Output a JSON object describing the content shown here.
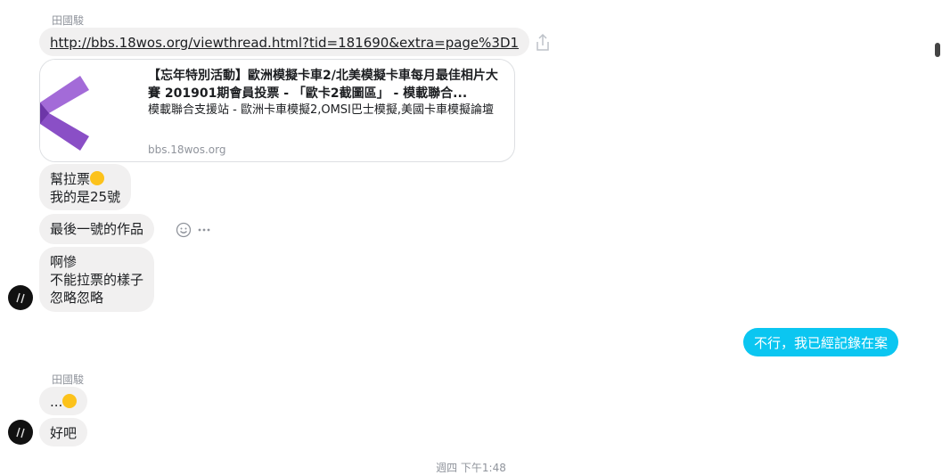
{
  "messages": {
    "sender_top": "田國駿",
    "link_url": "http://bbs.18wos.org/viewthread.html?tid=181690&extra=page%3D1",
    "card": {
      "title": "【忘年特別活動】歐洲模擬卡車2/北美模擬卡車每月最佳相片大賽 201901期會員投票 - 「歐卡2截圖區」 - 模載聯合...",
      "description": "模載聯合支援站 - 歐洲卡車模擬2,OMSI巴士模擬,美國卡車模擬論壇",
      "domain": "bbs.18wos.org"
    },
    "msg1_line1": "幫拉票",
    "msg1_line2": "我的是25號",
    "msg2": "最後一號的作品",
    "msg3_line1": "啊慘",
    "msg3_line2": "不能拉票的樣子",
    "msg3_line3": "忽略忽略",
    "outgoing": "不行，我已經記錄在案",
    "sender_bottom": "田國駿",
    "msg4": "...",
    "msg5": "好吧",
    "timestamp": "週四 下午1:48"
  },
  "icons": {
    "share": "share-icon",
    "emoji_reaction": "smiley-icon",
    "more": "more-icon"
  },
  "colors": {
    "incoming_bubble": "#f1f0f0",
    "outgoing_bubble": "#0bc6f1"
  }
}
